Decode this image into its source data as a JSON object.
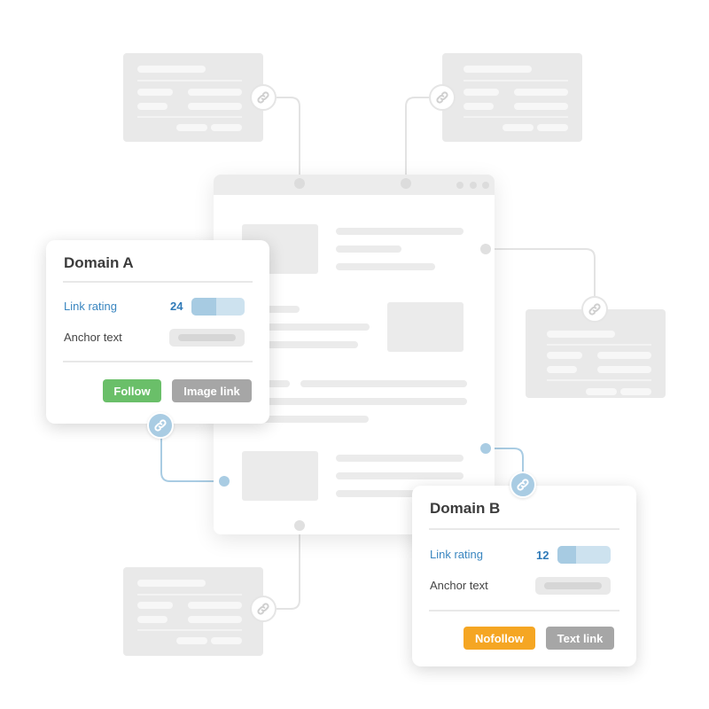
{
  "diagram": {
    "description": "Backlinks from external pages pointing to a website",
    "colors": {
      "follow": "#6abf69",
      "nofollow": "#f5a623",
      "link_type": "#a6a6a6",
      "rating_label": "#3a86c0",
      "rating_fill": "#a7cbe2",
      "rating_track": "#cde2ef",
      "active_connector": "#a9cce3",
      "inactive_connector": "#e3e3e3"
    }
  },
  "domain_a": {
    "title": "Domain A",
    "link_rating_label": "Link rating",
    "link_rating_value": "24",
    "link_rating_fill_fraction": 0.47,
    "anchor_text_label": "Anchor text",
    "follow_button": "Follow",
    "type_button": "Image link",
    "icon": "link-icon"
  },
  "domain_b": {
    "title": "Domain B",
    "link_rating_label": "Link rating",
    "link_rating_value": "12",
    "link_rating_fill_fraction": 0.35,
    "anchor_text_label": "Anchor text",
    "follow_button": "Nofollow",
    "type_button": "Text link",
    "icon": "link-icon"
  },
  "placeholder_cards": [
    {
      "position": "top-left",
      "icon": "link-icon"
    },
    {
      "position": "top-right",
      "icon": "link-icon"
    },
    {
      "position": "middle-right",
      "icon": "link-icon"
    },
    {
      "position": "bottom-left",
      "icon": "link-icon"
    }
  ]
}
